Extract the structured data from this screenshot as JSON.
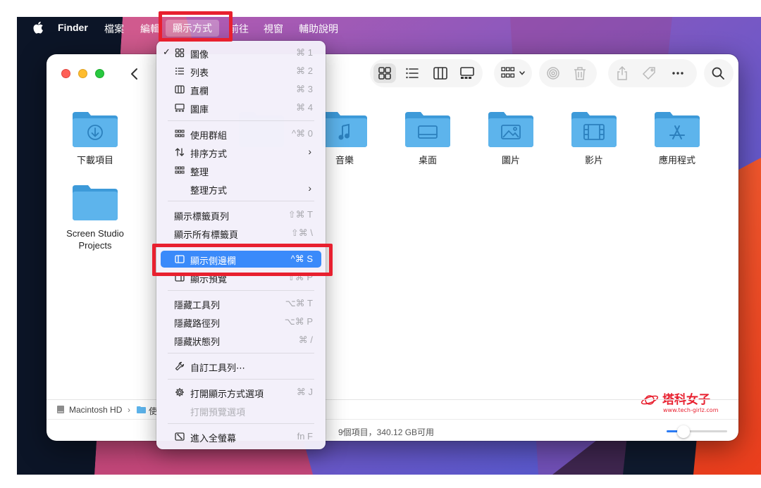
{
  "menubar": {
    "app": "Finder",
    "items": [
      "檔案",
      "編輯",
      "顯示方式",
      "前往",
      "視窗",
      "輔助說明"
    ],
    "active": "顯示方式"
  },
  "toolbar": {
    "back_icon": "chevron-left-icon",
    "view_icons": [
      "grid-view-icon",
      "list-view-icon",
      "column-view-icon",
      "gallery-view-icon"
    ],
    "group_icon": "group-by-icon",
    "airdrop_icon": "airdrop-icon",
    "trash_icon": "trash-icon",
    "share_icon": "share-icon",
    "tag_icon": "tag-icon",
    "more_icon": "more-icon",
    "search_icon": "search-icon"
  },
  "folders": [
    {
      "label": "下載項目",
      "icon": "download-icon"
    },
    {
      "label": "音樂",
      "icon": "music-icon"
    },
    {
      "label": "桌面",
      "icon": "desktop-icon"
    },
    {
      "label": "圖片",
      "icon": "photo-icon"
    },
    {
      "label": "影片",
      "icon": "film-icon"
    },
    {
      "label": "應用程式",
      "icon": "appstore-icon"
    },
    {
      "label": "Screen Studio Projects",
      "icon": ""
    }
  ],
  "menu": {
    "items": [
      {
        "label": "圖像",
        "shortcut": "⌘ 1",
        "icon": "grid-view-icon",
        "checked": true
      },
      {
        "label": "列表",
        "shortcut": "⌘ 2",
        "icon": "list-view-icon"
      },
      {
        "label": "直欄",
        "shortcut": "⌘ 3",
        "icon": "column-view-icon"
      },
      {
        "label": "圖庫",
        "shortcut": "⌘ 4",
        "icon": "gallery-view-icon"
      },
      {
        "label": "使用群組",
        "shortcut": "^⌘ 0",
        "icon": "group-by-icon"
      },
      {
        "label": "排序方式",
        "shortcut": "",
        "icon": "sort-icon",
        "submenu": true
      },
      {
        "label": "整理",
        "shortcut": "",
        "icon": "clean-up-icon"
      },
      {
        "label": "整理方式",
        "shortcut": "",
        "icon": "",
        "submenu": true
      },
      {
        "label": "顯示標籤頁列",
        "shortcut": "⇧⌘ T",
        "icon": ""
      },
      {
        "label": "顯示所有標籤頁",
        "shortcut": "⇧⌘ \\",
        "icon": ""
      },
      {
        "label": "顯示側邊欄",
        "shortcut": "^⌘ S",
        "icon": "sidebar-icon",
        "highlighted": true
      },
      {
        "label": "顯示預覽",
        "shortcut": "⇧⌘ P",
        "icon": "preview-icon"
      },
      {
        "label": "隱藏工具列",
        "shortcut": "⌥⌘ T",
        "icon": ""
      },
      {
        "label": "隱藏路徑列",
        "shortcut": "⌥⌘ P",
        "icon": ""
      },
      {
        "label": "隱藏狀態列",
        "shortcut": "⌘ /",
        "icon": ""
      },
      {
        "label": "自訂工具列⋯",
        "shortcut": "",
        "icon": "wrench-icon"
      },
      {
        "label": "打開顯示方式選項",
        "shortcut": "⌘ J",
        "icon": "gear-icon"
      },
      {
        "label": "打開預覽選項",
        "shortcut": "",
        "icon": "",
        "disabled": true
      },
      {
        "label": "進入全螢幕",
        "shortcut": "fn F",
        "icon": "fullscreen-icon"
      }
    ]
  },
  "pathbar": {
    "disk": "Macintosh HD",
    "folder": "使",
    "separator": "›"
  },
  "statusbar": {
    "text": "9個項目，340.12 GB可用",
    "icon_size": 0.28
  },
  "watermark": {
    "title": "塔科女子",
    "url": "www.tech-girlz.com"
  },
  "colors": {
    "folder": "#5db4ec",
    "folder_dark": "#3d9ad9",
    "highlight": "#3a8afa",
    "annotation": "#e8202f"
  }
}
